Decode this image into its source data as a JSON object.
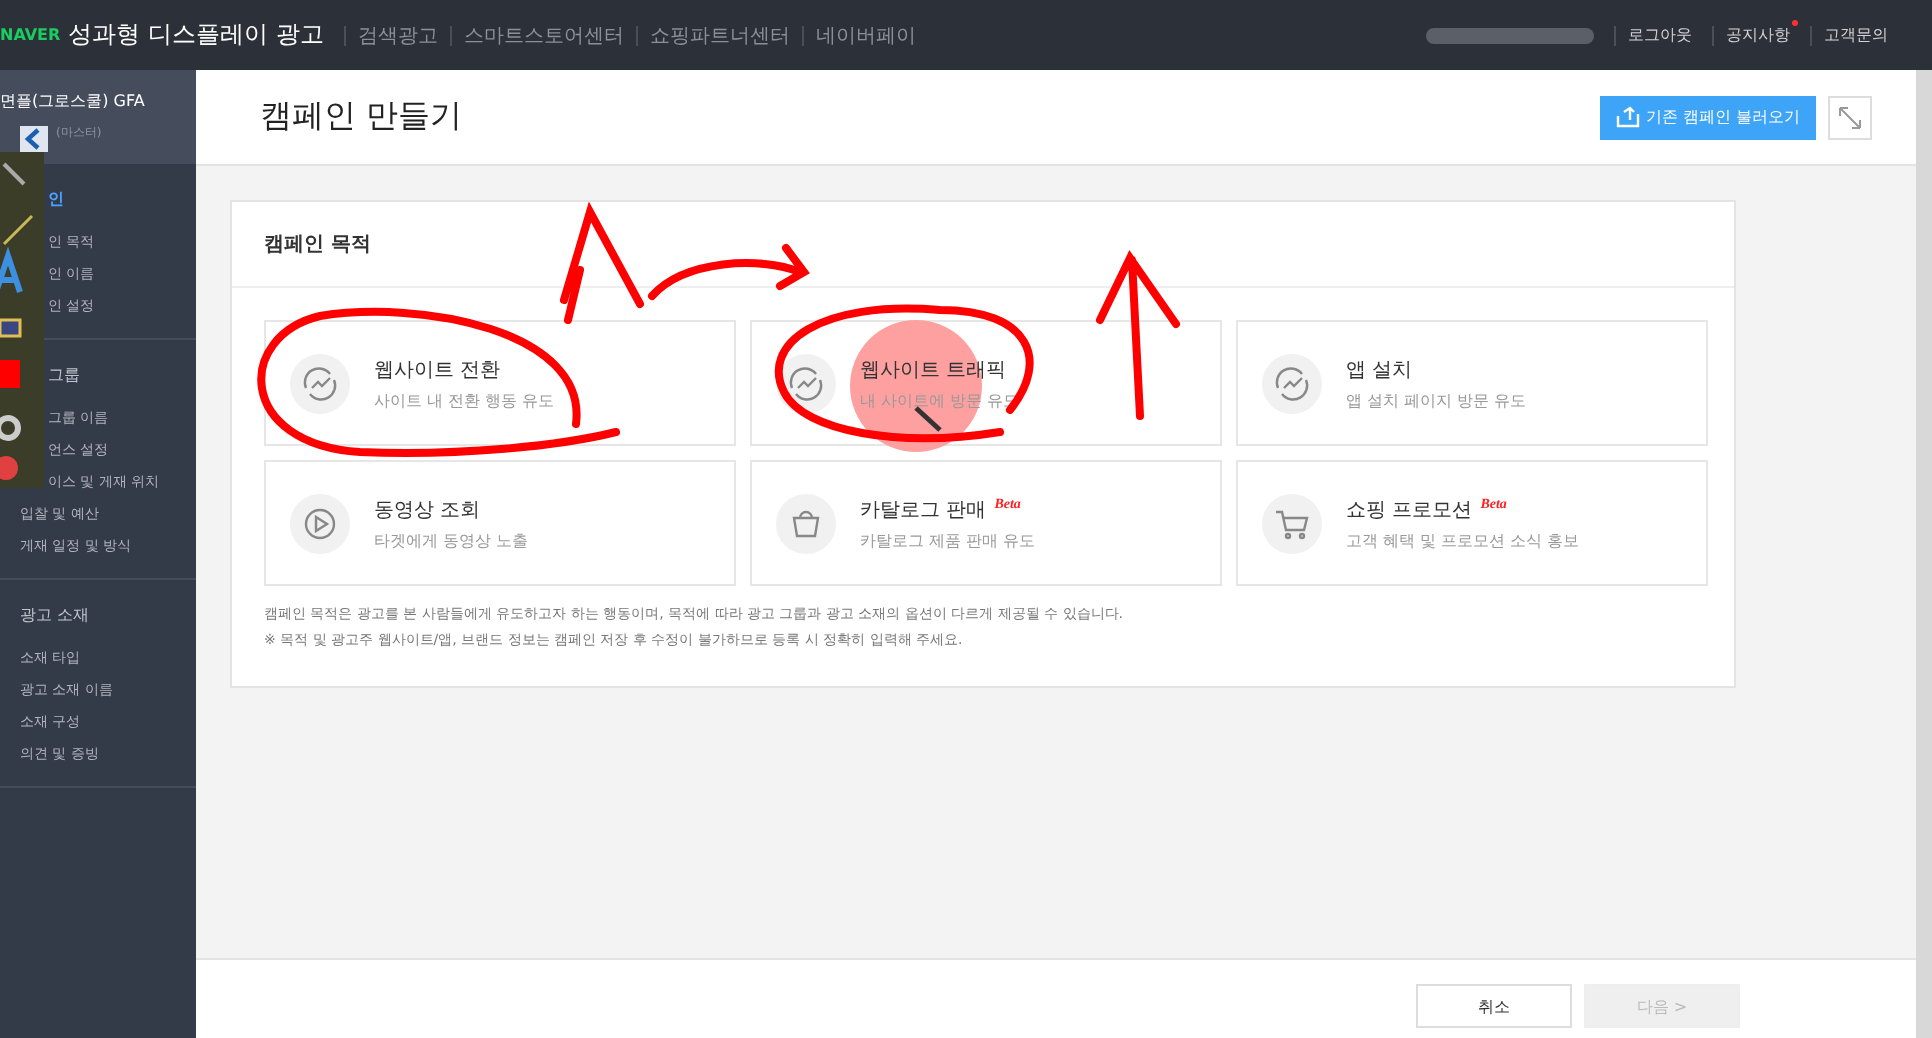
{
  "top_bar": {
    "logo": "NAVER",
    "product": "성과형 디스플레이 광고",
    "nav": [
      "검색광고",
      "스마트스토어센터",
      "쇼핑파트너센터",
      "네이버페이"
    ],
    "links": [
      {
        "label": "로그아웃",
        "new": false
      },
      {
        "label": "공지사항",
        "new": true
      },
      {
        "label": "고객문의",
        "new": false
      }
    ]
  },
  "sidebar": {
    "account": "면플(그로스쿨) GFA",
    "role": "(마스터)",
    "sections": [
      {
        "title": "인",
        "active": true,
        "items": [
          "인 목적",
          "인 이름",
          "인 설정"
        ]
      },
      {
        "title": "그룹",
        "active": false,
        "items": [
          "그룹 이름",
          "언스 설정",
          "이스 및 게재 위치",
          "입찰 및 예산",
          "게재 일정 및 방식"
        ]
      },
      {
        "title": "광고 소재",
        "active": false,
        "items": [
          "소재 타입",
          "광고 소재 이름",
          "소재 구성",
          "의견 및 증빙"
        ]
      }
    ]
  },
  "header": {
    "title": "캠페인 만들기",
    "load_button": "기존 캠페인 불러오기"
  },
  "objective_panel": {
    "title": "캠페인 목적",
    "cards": [
      {
        "kind": "conversion",
        "title": "웹사이트 전환",
        "desc": "사이트 내 전환 행동 유도"
      },
      {
        "kind": "traffic",
        "title": "웹사이트 트래픽",
        "desc": "내 사이트에 방문 유도"
      },
      {
        "kind": "app",
        "title": "앱 설치",
        "desc": "앱 설치 페이지 방문 유도"
      },
      {
        "kind": "video",
        "title": "동영상 조회",
        "desc": "타겟에게 동영상 노출"
      },
      {
        "kind": "catalog",
        "title": "카탈로그 판매",
        "desc": "카탈로그 제품 판매 유도",
        "badge": "Beta"
      },
      {
        "kind": "shopping",
        "title": "쇼핑 프로모션",
        "desc": "고객 혜택 및 프로모션 소식 홍보",
        "badge": "Beta"
      }
    ],
    "notes": [
      "캠페인 목적은 광고를 본 사람들에게 유도하고자 하는 행동이며, 목적에 따라 광고 그룹과 광고 소재의 옵션이 다르게 제공될 수 있습니다.",
      "※ 목적 및 광고주 웹사이트/앱, 브랜드 정보는 캠페인 저장 후 수정이 불가하므로 등록 시 정확히 입력해 주세요."
    ]
  },
  "footer": {
    "buttons": [
      {
        "label": "취소",
        "disabled": false
      },
      {
        "label": "다음 >",
        "disabled": true
      }
    ]
  }
}
